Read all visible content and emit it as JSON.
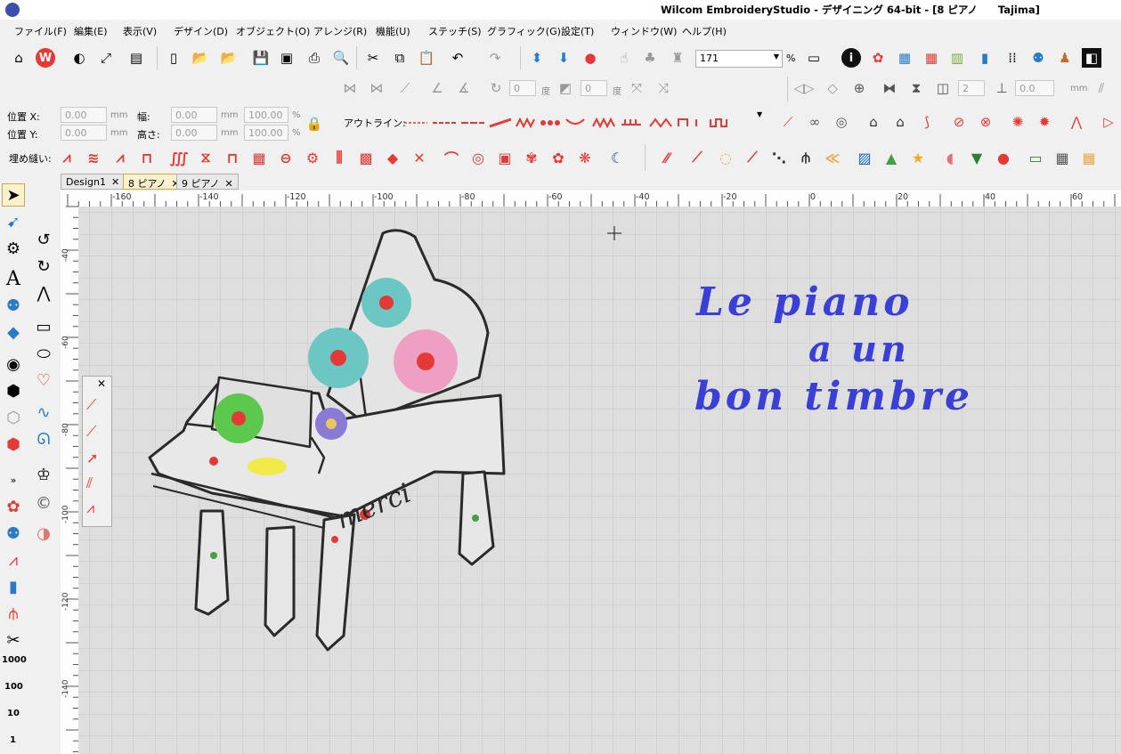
{
  "titlebar": {
    "title": "Wilcom EmbroideryStudio - デザイニング 64-bit - [8 ピアノ　　Tajima]"
  },
  "menu": [
    "ファイル(F)",
    "編集(E)",
    "表示(V)",
    "デザイン(D)",
    "オブジェクト(O)",
    "アレンジ(R)",
    "機能(U)",
    "ステッチ(S)",
    "グラフィック(G)",
    "設定(T)",
    "ウィンドウ(W)",
    "ヘルプ(H)"
  ],
  "toolbar": {
    "zoom_value": "171",
    "zoom_unit": "%"
  },
  "rotate": {
    "angle1": "0",
    "angle1_unit": "度",
    "angle2": "0",
    "angle2_unit": "度",
    "count": "2",
    "spacing": "0.0",
    "spacing_unit": "mm"
  },
  "position": {
    "x_label": "位置 X:",
    "y_label": "位置 Y:",
    "x_value": "0.00",
    "y_value": "0.00",
    "unit": "mm",
    "width_label": "幅:",
    "height_label": "高さ:",
    "width_value": "0.00",
    "height_value": "0.00",
    "width_pct": "100.00",
    "height_pct": "100.00",
    "pct_unit": "%"
  },
  "outline": {
    "label": "アウトライン:"
  },
  "fill": {
    "label": "埋め縫い:"
  },
  "tabs": [
    {
      "label": "Design1",
      "close": "✕"
    },
    {
      "label": "8 ピアノ",
      "close": "✕"
    },
    {
      "label": "9 ピアノ",
      "close": "✕"
    }
  ],
  "ruler": {
    "h_labels": [
      "-160",
      "-140",
      "-120",
      "-100",
      "-80",
      "-60",
      "-40",
      "-20",
      "0",
      "20",
      "40",
      "60"
    ],
    "v_labels": [
      "-40",
      "-60",
      "-80",
      "-100",
      "-120",
      "-140"
    ]
  },
  "design": {
    "piano_text": "merci",
    "script_line1": "Le piano",
    "script_line2": "a un",
    "script_line3": "bon timbre"
  },
  "left_tools": {
    "stitch_lengths": [
      "1000",
      "100",
      "10",
      "1"
    ]
  },
  "colors": {
    "accent": "#3a3fd6",
    "outline_red": "#e53935",
    "canvas": "#dedede",
    "grid": "#c6c6c6"
  }
}
